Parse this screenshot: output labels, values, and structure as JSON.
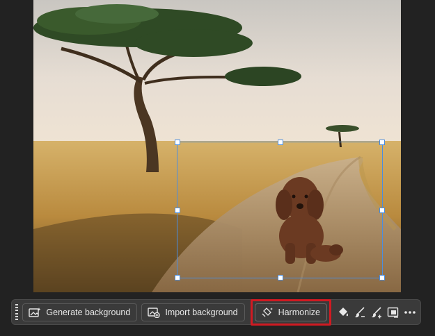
{
  "toolbar": {
    "generate_background_label": "Generate background",
    "import_background_label": "Import background",
    "harmonize_label": "Harmonize"
  },
  "colors": {
    "app_background": "#222222",
    "toolbar_background": "#3a3a3a",
    "selection_border": "#4a8de0",
    "highlight_border": "#d11a22"
  },
  "icons": [
    "generate-background-icon",
    "import-background-icon",
    "harmonize-icon",
    "fill-icon",
    "brush-subtract-icon",
    "brush-add-icon",
    "mask-icon",
    "more-icon"
  ]
}
